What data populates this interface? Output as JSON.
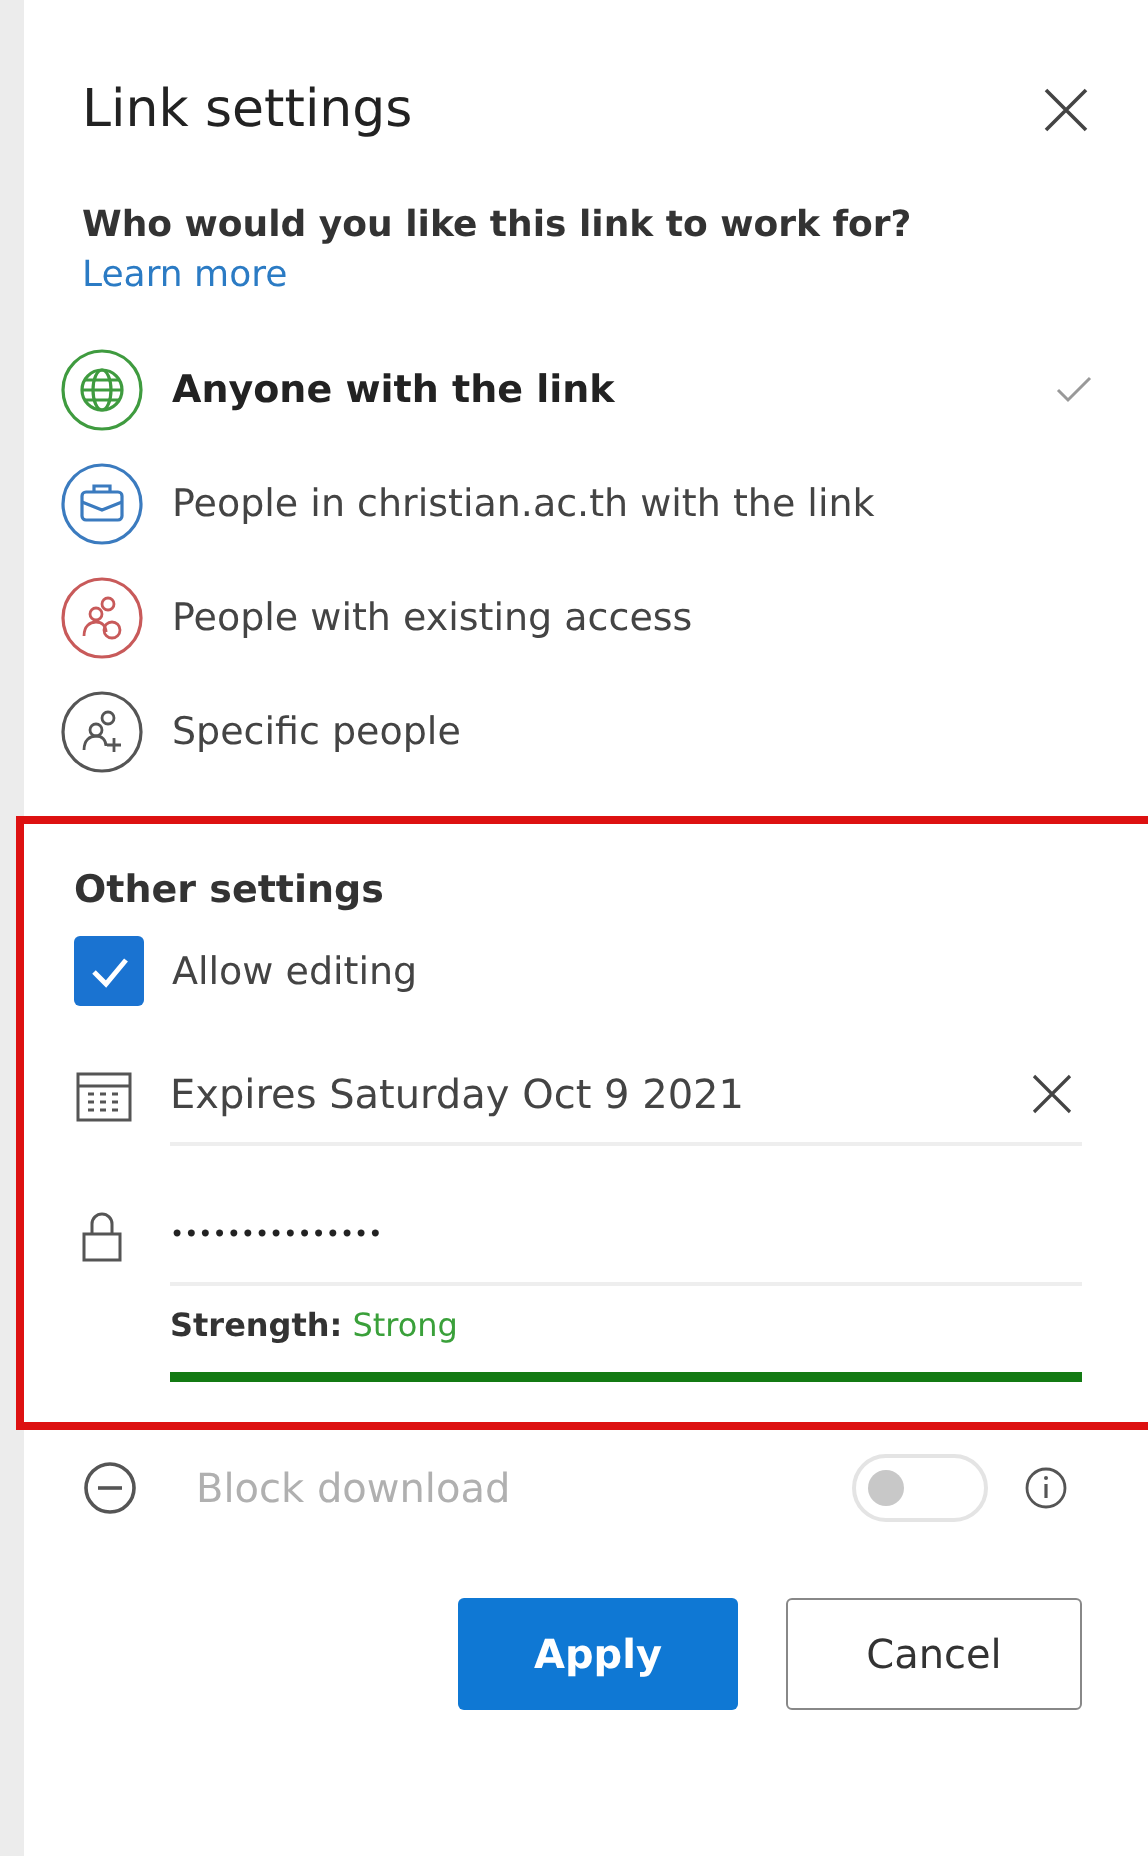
{
  "title": "Link settings",
  "question": "Who would you like this link to work for?",
  "learn_more": "Learn more",
  "options": [
    {
      "label": "Anyone with the link",
      "kind": "globe",
      "color": "#3f9b3f",
      "selected": true
    },
    {
      "label": "People in christian.ac.th with the link",
      "kind": "briefcase",
      "color": "#3b7bbf",
      "selected": false
    },
    {
      "label": "People with existing access",
      "kind": "people",
      "color": "#c85a5a",
      "selected": false
    },
    {
      "label": "Specific people",
      "kind": "people-add",
      "color": "#555555",
      "selected": false
    }
  ],
  "other_settings": {
    "heading": "Other settings",
    "highlighted": true,
    "allow_editing": {
      "label": "Allow editing",
      "checked": true
    },
    "expiry": {
      "value": "Expires Saturday Oct 9 2021"
    },
    "password": {
      "value": "•••••••••••••••",
      "strength_label": "Strength:",
      "strength_value": "Strong",
      "level": 1
    }
  },
  "block_download": {
    "label": "Block download",
    "on": false,
    "disabled": true
  },
  "buttons": [
    {
      "label": "Apply",
      "kind": "primary"
    },
    {
      "label": "Cancel",
      "kind": "secondary"
    }
  ]
}
